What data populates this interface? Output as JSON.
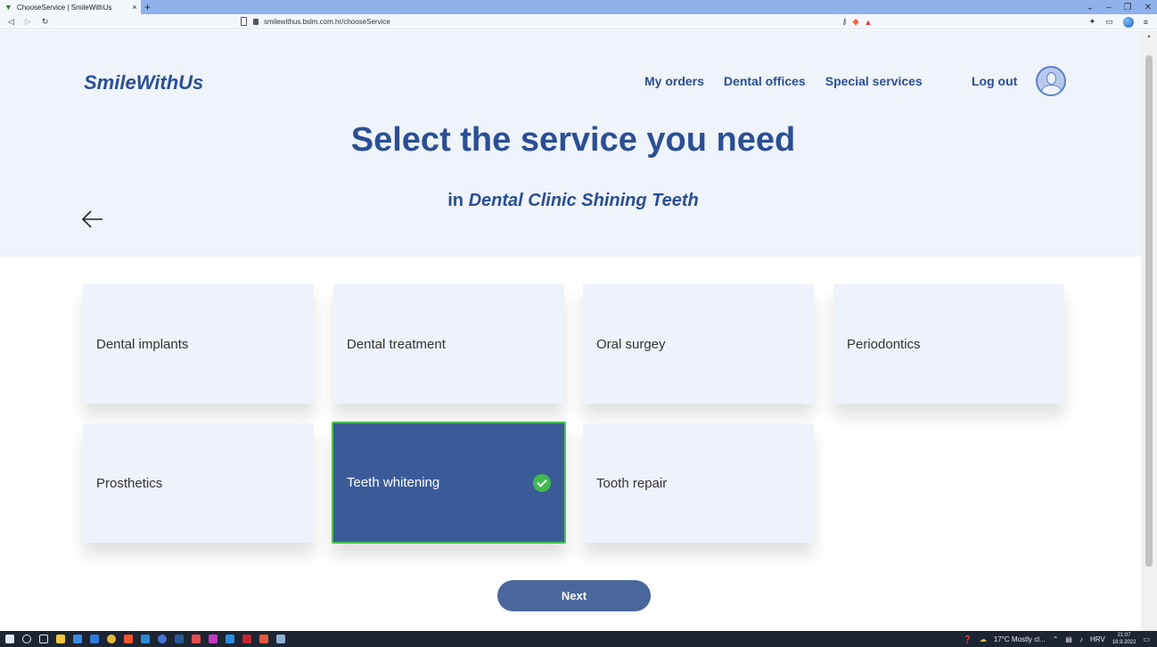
{
  "browser": {
    "tab_title": "ChooseService | SmileWithUs",
    "tab_close": "×",
    "new_tab": "+",
    "url": "smilewithus.bslm.com.hr/chooseService",
    "window_controls": [
      "⌄",
      "–",
      "❐",
      "✕"
    ]
  },
  "header": {
    "logo": "SmileWithUs",
    "nav": [
      "My orders",
      "Dental offices",
      "Special services"
    ],
    "logout": "Log out"
  },
  "main": {
    "title": "Select the service you need",
    "subtitle_prefix": "in ",
    "clinic_name": "Dental Clinic Shining Teeth",
    "services": [
      {
        "label": "Dental implants",
        "selected": false
      },
      {
        "label": "Dental treatment",
        "selected": false
      },
      {
        "label": "Oral surgey",
        "selected": false
      },
      {
        "label": "Periodontics",
        "selected": false
      },
      {
        "label": "Prosthetics",
        "selected": false
      },
      {
        "label": "Teeth whitening",
        "selected": true
      },
      {
        "label": "Tooth repair",
        "selected": false
      }
    ],
    "next_label": "Next"
  },
  "taskbar": {
    "weather": "17°C  Mostly cl...",
    "language": "HRV",
    "time": "21:07",
    "date": "18.9.2022"
  },
  "colors": {
    "brand": "#2b4f93",
    "hero_bg": "#eff3fa",
    "card_bg": "#eef2fa",
    "selected_bg": "#3b5b98",
    "selected_border": "#4bc35a",
    "button_bg": "#4a679c"
  }
}
